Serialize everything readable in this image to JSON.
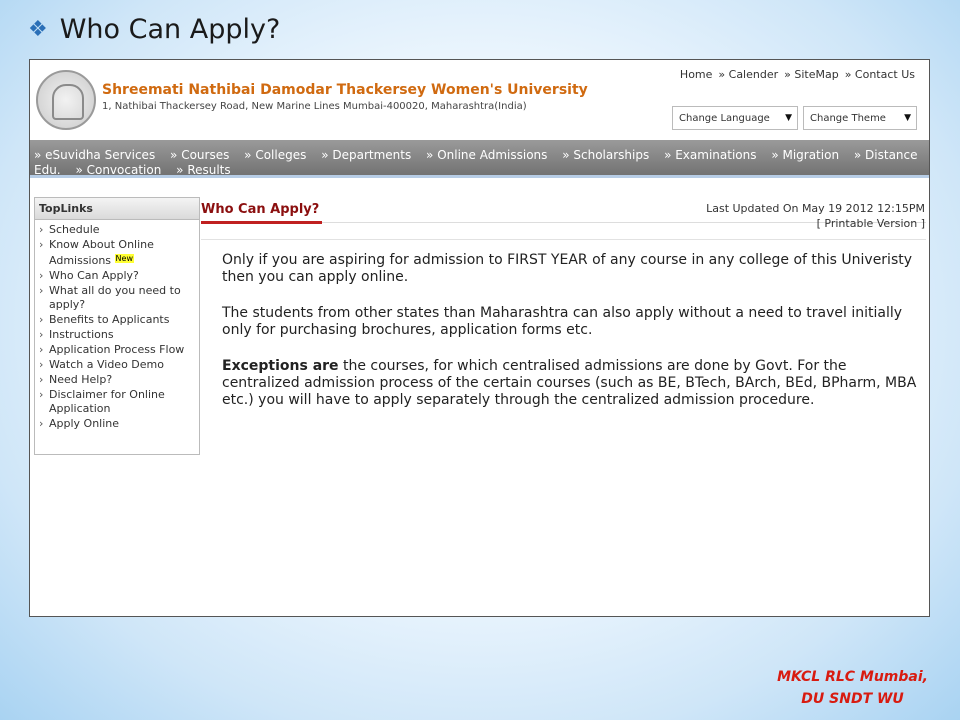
{
  "slide": {
    "title": "Who Can Apply?",
    "footer_line1": "MKCL RLC Mumbai,",
    "footer_line2": "DU SNDT WU"
  },
  "site": {
    "university_name": "Shreemati Nathibai Damodar Thackersey Women's University",
    "address": "1, Nathibai Thackersey Road, New Marine Lines Mumbai-400020, Maharashtra(India)",
    "top_links": [
      "Home",
      "» Calender",
      "» SiteMap",
      "» Contact Us"
    ],
    "change_language": "Change Language",
    "change_theme": "Change Theme"
  },
  "nav": {
    "row1": [
      "» eSuvidha Services",
      "» Courses",
      "» Colleges",
      "» Departments",
      "» Online Admissions",
      "» Scholarships",
      "» Examinations",
      "» Migration",
      "» Distance"
    ],
    "row2": [
      "Edu.",
      "» Convocation",
      "» Results"
    ]
  },
  "sidebar": {
    "heading": "TopLinks",
    "items": [
      {
        "label": "Schedule"
      },
      {
        "label": "Know About Online Admissions",
        "badge": "New"
      },
      {
        "label": "Who Can Apply?"
      },
      {
        "label": "What all do you need to apply?"
      },
      {
        "label": "Benefits to Applicants"
      },
      {
        "label": "Instructions"
      },
      {
        "label": "Application Process Flow"
      },
      {
        "label": "Watch a Video Demo"
      },
      {
        "label": "Need Help?"
      },
      {
        "label": "Disclaimer for Online Application"
      },
      {
        "label": "Apply Online"
      }
    ]
  },
  "main": {
    "heading": "Who Can Apply?",
    "last_updated": "Last Updated On May 19 2012 12:15PM",
    "printable": "[ Printable Version ]",
    "para1": "Only if you are aspiring for admission to FIRST YEAR of any course in any college of this Univeristy then you can apply online.",
    "para2": "The students from other states than Maharashtra can also apply without a need to travel initially only for purchasing brochures, application forms etc.",
    "para3_bold": "Exceptions are",
    "para3_rest": " the courses, for which centralised admissions are done by Govt. For the centralized admission process of the certain courses (such as BE, BTech, BArch, BEd, BPharm, MBA etc.) you will have to apply separately through the centralized admission procedure."
  },
  "colors": {
    "title_bullet": "#2a6fb7",
    "footer_text": "#d81b10",
    "university_name": "#d06a10",
    "page_heading": "#8b0f0f",
    "nav_bar": "#7f7f7f"
  }
}
